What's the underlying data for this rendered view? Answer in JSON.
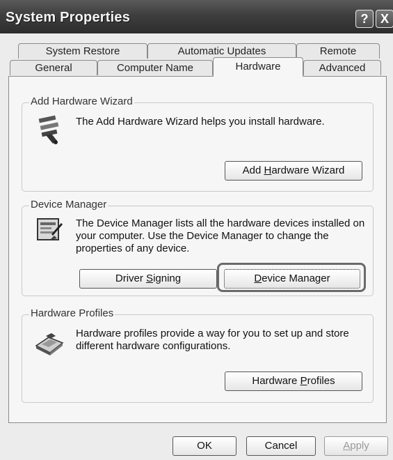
{
  "window": {
    "title": "System Properties",
    "help_glyph": "?",
    "close_glyph": "X"
  },
  "tabs_row1": [
    {
      "label": "System Restore"
    },
    {
      "label": "Automatic Updates"
    },
    {
      "label": "Remote"
    }
  ],
  "tabs_row2": [
    {
      "label": "General"
    },
    {
      "label": "Computer Name"
    },
    {
      "label": "Hardware",
      "active": true
    },
    {
      "label": "Advanced"
    }
  ],
  "groups": {
    "add_hardware": {
      "title": "Add Hardware Wizard",
      "description": "The Add Hardware Wizard helps you install hardware.",
      "button": {
        "pre": "Add ",
        "key": "H",
        "post": "ardware Wizard"
      },
      "icon": "add-hardware-icon"
    },
    "device_manager": {
      "title": "Device Manager",
      "description": "The Device Manager lists all the hardware devices installed on your computer. Use the Device Manager to change the properties of any device.",
      "driver_button": {
        "pre": "Driver ",
        "key": "S",
        "post": "igning"
      },
      "manager_button": {
        "pre": "",
        "key": "D",
        "post": "evice Manager"
      },
      "icon": "device-manager-icon"
    },
    "hardware_profiles": {
      "title": "Hardware Profiles",
      "description": "Hardware profiles provide a way for you to set up and store different hardware configurations.",
      "button": {
        "pre": "Hardware ",
        "key": "P",
        "post": "rofiles"
      },
      "icon": "hardware-profiles-icon"
    }
  },
  "footer": {
    "ok_label": "OK",
    "cancel_label": "Cancel",
    "apply": {
      "pre": "",
      "key": "A",
      "post": "pply",
      "disabled": true
    }
  },
  "colors": {
    "titlebar": "#3e3e3e",
    "dialog_bg": "#ececec",
    "panel_bg": "#f6f6f6",
    "highlight_ring": "#6a6a6a"
  }
}
